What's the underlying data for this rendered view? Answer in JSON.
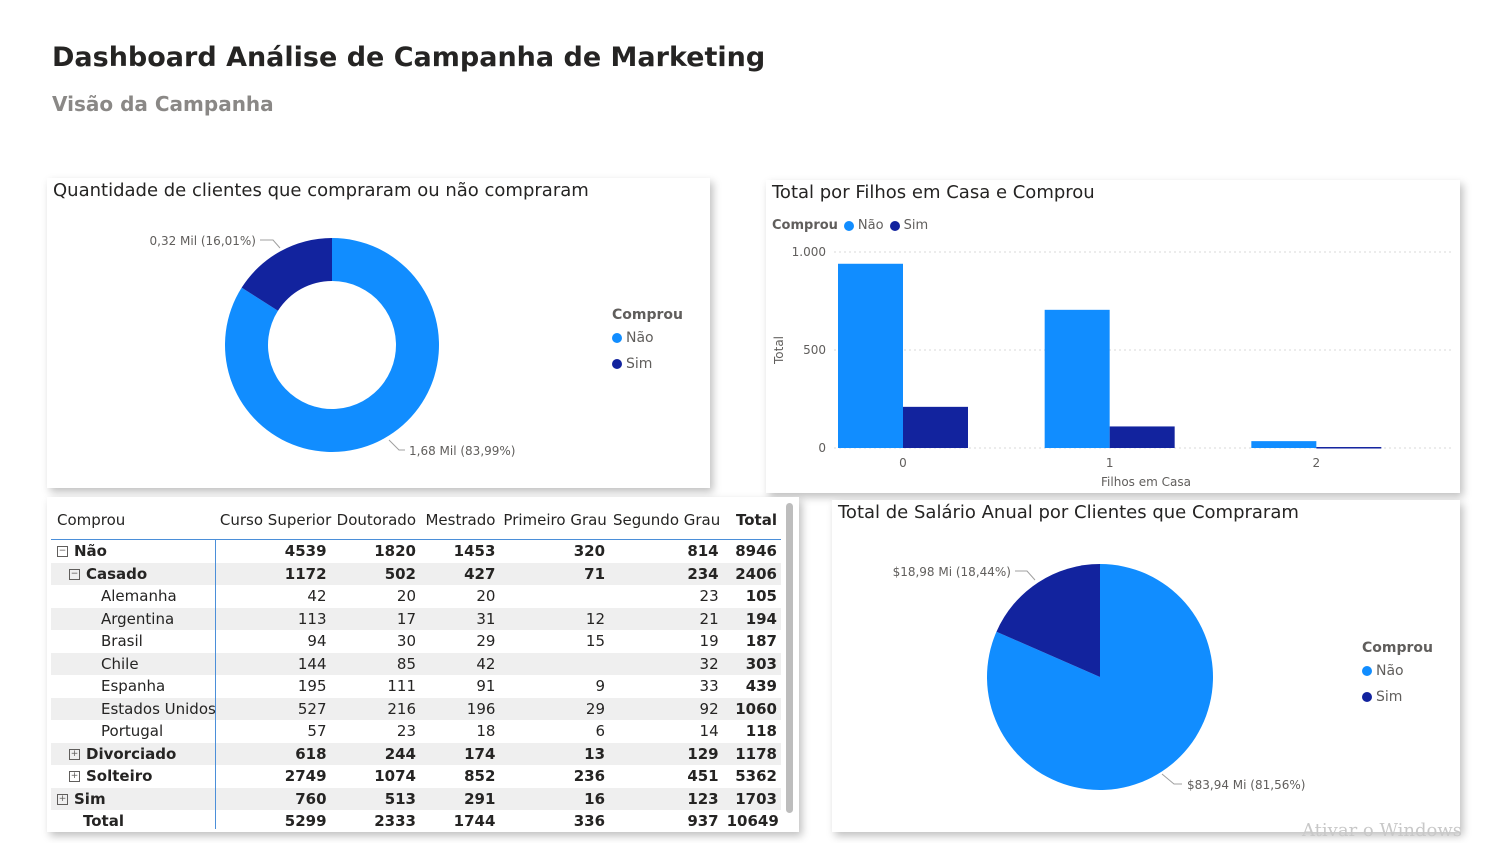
{
  "header": {
    "title": "Dashboard Análise de Campanha de Marketing",
    "subtitle": "Visão da Campanha"
  },
  "colors": {
    "nao": "#118dff",
    "sim": "#12239e"
  },
  "donut": {
    "title": "Quantidade de clientes que compraram ou não compraram",
    "legend_title": "Comprou",
    "legend": [
      "Não",
      "Sim"
    ],
    "label_sim": "0,32 Mil (16,01%)",
    "label_nao": "1,68 Mil (83,99%)"
  },
  "bars": {
    "title": "Total por Filhos em Casa e Comprou",
    "legend_title": "Comprou",
    "legend": [
      "Não",
      "Sim"
    ],
    "ylabel": "Total",
    "xlabel": "Filhos em Casa",
    "yticks": [
      "1.000",
      "500",
      "0"
    ]
  },
  "pie": {
    "title": "Total de Salário Anual por Clientes que Compraram",
    "legend_title": "Comprou",
    "legend": [
      "Não",
      "Sim"
    ],
    "label_sim": "$18,98 Mi (18,44%)",
    "label_nao": "$83,94 Mi (81,56%)"
  },
  "matrix": {
    "headers": [
      "Comprou",
      "Curso Superior",
      "Doutorado",
      "Mestrado",
      "Primeiro Grau",
      "Segundo Grau",
      "Total"
    ],
    "rows": [
      {
        "label": "Não",
        "level": 0,
        "icon": "−",
        "bold": true,
        "cells": [
          "4539",
          "1820",
          "1453",
          "320",
          "814",
          "8946"
        ]
      },
      {
        "label": "Casado",
        "level": 1,
        "icon": "−",
        "bold": true,
        "cells": [
          "1172",
          "502",
          "427",
          "71",
          "234",
          "2406"
        ]
      },
      {
        "label": "Alemanha",
        "level": 2,
        "icon": "",
        "bold": false,
        "cells": [
          "42",
          "20",
          "20",
          "",
          "23",
          "105"
        ]
      },
      {
        "label": "Argentina",
        "level": 2,
        "icon": "",
        "bold": false,
        "cells": [
          "113",
          "17",
          "31",
          "12",
          "21",
          "194"
        ]
      },
      {
        "label": "Brasil",
        "level": 2,
        "icon": "",
        "bold": false,
        "cells": [
          "94",
          "30",
          "29",
          "15",
          "19",
          "187"
        ]
      },
      {
        "label": "Chile",
        "level": 2,
        "icon": "",
        "bold": false,
        "cells": [
          "144",
          "85",
          "42",
          "",
          "32",
          "303"
        ]
      },
      {
        "label": "Espanha",
        "level": 2,
        "icon": "",
        "bold": false,
        "cells": [
          "195",
          "111",
          "91",
          "9",
          "33",
          "439"
        ]
      },
      {
        "label": "Estados Unidos",
        "level": 2,
        "icon": "",
        "bold": false,
        "cells": [
          "527",
          "216",
          "196",
          "29",
          "92",
          "1060"
        ]
      },
      {
        "label": "Portugal",
        "level": 2,
        "icon": "",
        "bold": false,
        "cells": [
          "57",
          "23",
          "18",
          "6",
          "14",
          "118"
        ]
      },
      {
        "label": "Divorciado",
        "level": 1,
        "icon": "+",
        "bold": true,
        "cells": [
          "618",
          "244",
          "174",
          "13",
          "129",
          "1178"
        ]
      },
      {
        "label": "Solteiro",
        "level": 1,
        "icon": "+",
        "bold": true,
        "cells": [
          "2749",
          "1074",
          "852",
          "236",
          "451",
          "5362"
        ]
      },
      {
        "label": "Sim",
        "level": 0,
        "icon": "+",
        "bold": true,
        "cells": [
          "760",
          "513",
          "291",
          "16",
          "123",
          "1703"
        ]
      },
      {
        "label": "Total",
        "level": 0,
        "icon": "",
        "bold": true,
        "cells": [
          "5299",
          "2333",
          "1744",
          "336",
          "937",
          "10649"
        ]
      }
    ]
  },
  "watermark": "Ativar o Windows",
  "chart_data": [
    {
      "type": "pie",
      "title": "Quantidade de clientes que compraram ou não compraram",
      "donut": true,
      "legend_title": "Comprou",
      "categories": [
        "Não",
        "Sim"
      ],
      "values": [
        1.68,
        0.32
      ],
      "unit": "Mil",
      "percentages": [
        83.99,
        16.01
      ],
      "data_labels": [
        "1,68 Mil (83,99%)",
        "0,32 Mil (16,01%)"
      ],
      "colors": [
        "#118dff",
        "#12239e"
      ],
      "legend_position": "right"
    },
    {
      "type": "bar",
      "title": "Total por Filhos em Casa e Comprou",
      "categories": [
        "0",
        "1",
        "2"
      ],
      "xlabel": "Filhos em Casa",
      "ylabel": "Total",
      "ylim": [
        0,
        1000
      ],
      "yticks": [
        0,
        500,
        1000
      ],
      "grid": true,
      "legend_title": "Comprou",
      "legend_position": "top-left",
      "series": [
        {
          "name": "Não",
          "values": [
            940,
            705,
            35
          ],
          "color": "#118dff"
        },
        {
          "name": "Sim",
          "values": [
            210,
            110,
            5
          ],
          "color": "#12239e"
        }
      ]
    },
    {
      "type": "pie",
      "title": "Total de Salário Anual por Clientes que Compraram",
      "legend_title": "Comprou",
      "categories": [
        "Não",
        "Sim"
      ],
      "values": [
        83.94,
        18.98
      ],
      "unit": "$ Mi",
      "percentages": [
        81.56,
        18.44
      ],
      "data_labels": [
        "$83,94 Mi (81,56%)",
        "$18,98 Mi (18,44%)"
      ],
      "colors": [
        "#118dff",
        "#12239e"
      ],
      "legend_position": "right"
    }
  ]
}
